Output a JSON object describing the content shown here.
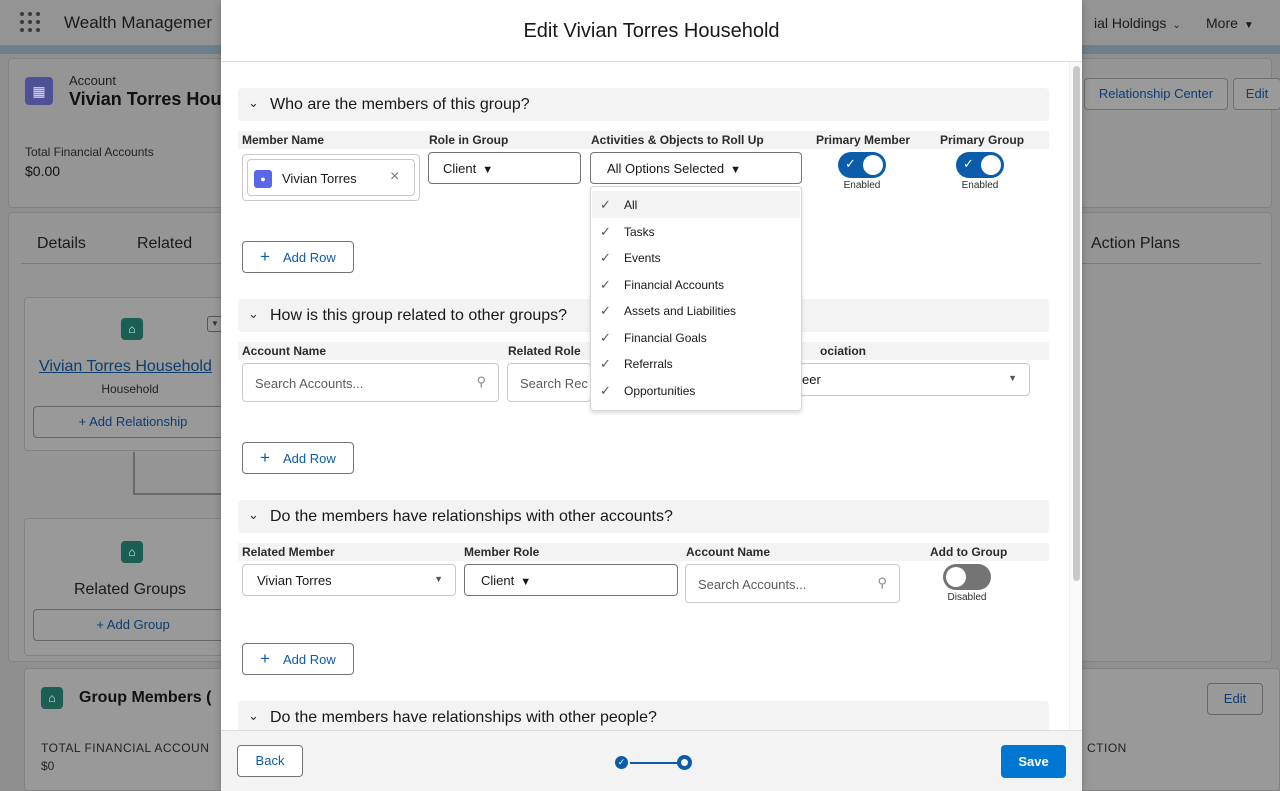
{
  "background": {
    "app_name": "Wealth Managemer",
    "nav_right": "ial Holdings",
    "nav_more": "More",
    "account": {
      "label": "Account",
      "name": "Vivian Torres Hou",
      "fin_label": "Total Financial Accounts",
      "fin_value": "$0.00",
      "relationship_center_button": "Relationship Center",
      "edit_button": "Edit"
    },
    "tabs": [
      "Details",
      "Related",
      "Action Plans"
    ],
    "household": {
      "name": "Vivian Torres Household",
      "type": "Household",
      "add_relationship": "+ Add Relationship"
    },
    "related_groups": {
      "title": "Related Groups",
      "add_group": "+ Add Group"
    },
    "group_members": {
      "title": "Group Members (",
      "fin_label": "TOTAL FINANCIAL ACCOUN",
      "fin_value": "$0",
      "edit_button": "Edit",
      "action_label": "CTION"
    }
  },
  "modal": {
    "title": "Edit Vivian Torres Household",
    "sections": {
      "members": {
        "title": "Who are the members of this group?",
        "columns": [
          "Member Name",
          "Role in Group",
          "Activities & Objects to Roll Up",
          "Primary Member",
          "Primary Group"
        ],
        "member_name": "Vivian Torres",
        "role": "Client",
        "rollup": "All Options Selected",
        "primary_member_state": "Enabled",
        "primary_group_state": "Enabled",
        "add_row": "Add Row"
      },
      "groups": {
        "title": "How is this group related to other groups?",
        "columns": [
          "Account Name",
          "Related Role",
          "ociation"
        ],
        "account_placeholder": "Search Accounts...",
        "role_placeholder": "Search Rec",
        "association_value": "eer",
        "add_row": "Add Row"
      },
      "accounts": {
        "title": "Do the members have relationships with other accounts?",
        "columns": [
          "Related Member",
          "Member Role",
          "Account Name",
          "Add to Group"
        ],
        "related_member": "Vivian Torres",
        "member_role": "Client",
        "account_placeholder": "Search Accounts...",
        "add_to_group_state": "Disabled",
        "add_row": "Add Row"
      },
      "people": {
        "title": "Do the members have relationships with other people?"
      }
    },
    "rollup_menu": [
      "All",
      "Tasks",
      "Events",
      "Financial Accounts",
      "Assets and Liabilities",
      "Financial Goals",
      "Referrals",
      "Opportunities"
    ],
    "footer": {
      "back": "Back",
      "save": "Save",
      "progress_steps": 2,
      "current_step": 2
    }
  },
  "colors": {
    "brand_blue": "#0176d3",
    "toggle_on": "#0b5cab",
    "toggle_off": "#747474"
  }
}
